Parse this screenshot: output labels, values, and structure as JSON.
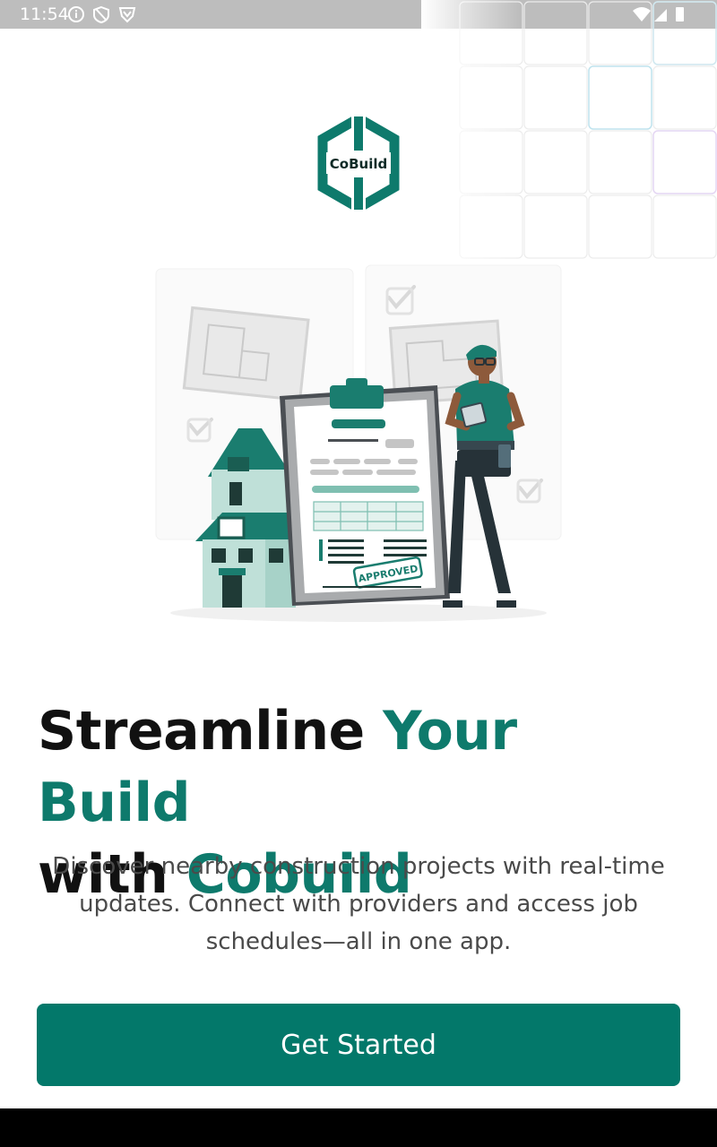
{
  "status_bar": {
    "time": "11:54",
    "left_icons": [
      "info-icon",
      "shield-icon",
      "vpn-shield-icon"
    ],
    "right_icons": [
      "wifi-icon",
      "signal-icon",
      "battery-icon"
    ]
  },
  "logo": {
    "text": "CoBuild",
    "color": "#0e7a6c"
  },
  "illustration": {
    "stamp_text": "APPROVED",
    "description_icons": [
      "blueprint",
      "house",
      "clipboard",
      "worker"
    ]
  },
  "headline": {
    "part1": "Streamline ",
    "part2": "Your Build",
    "part3": "with ",
    "part4": "Cobuild"
  },
  "subtitle": "Discover nearby construction projects with real-time updates. Connect with providers and access job schedules—all in one app.",
  "cta": {
    "label": "Get Started"
  },
  "colors": {
    "accent": "#0e7a6c",
    "button": "#03786a",
    "status_bar": "#bdbdbd"
  }
}
